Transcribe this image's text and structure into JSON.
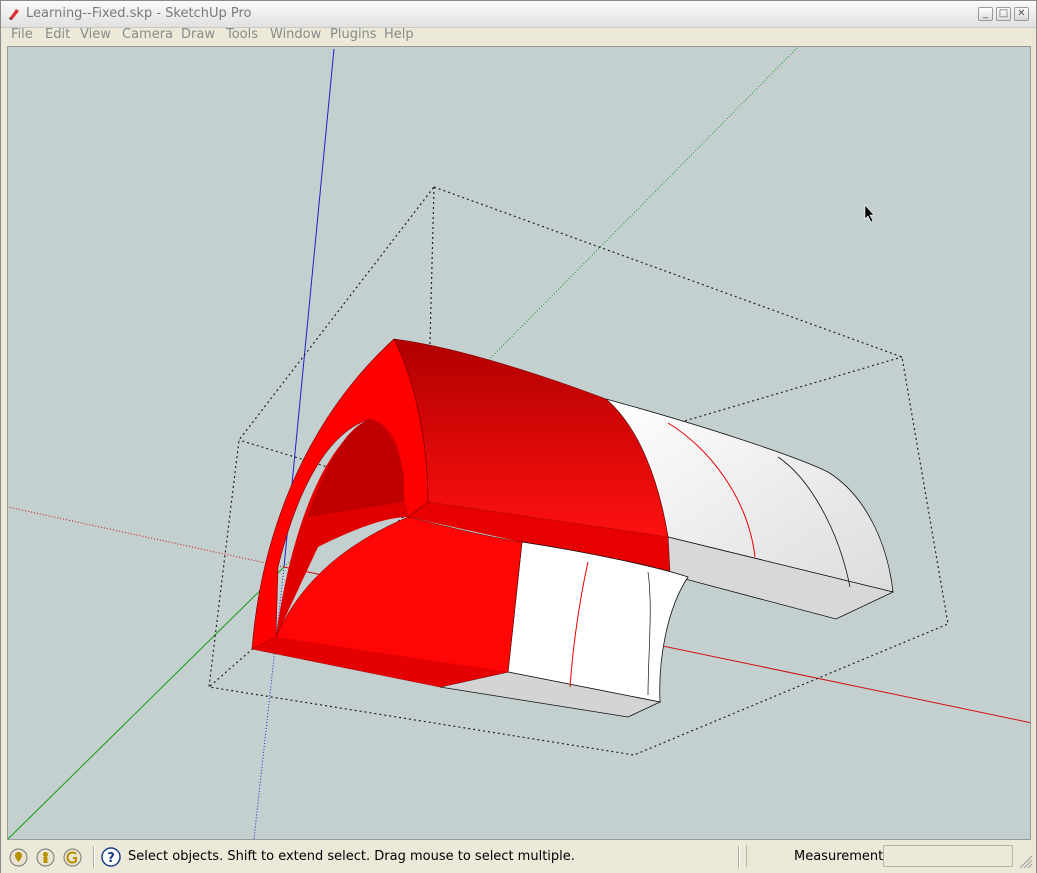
{
  "window": {
    "title": "Learning--Fixed.skp - SketchUp Pro",
    "controls": {
      "minimize": "minimize-icon",
      "maximize": "maximize-icon",
      "close": "close-icon"
    }
  },
  "menubar": {
    "items": [
      "File",
      "Edit",
      "View",
      "Camera",
      "Draw",
      "Tools",
      "Window",
      "Plugins",
      "Help"
    ]
  },
  "viewport": {
    "background_color": "#c4cfd0",
    "model_face_color": "#ff0000",
    "model_back_face_color": "#ffffff",
    "axis_colors": {
      "red": "#d11",
      "green": "#0a0",
      "blue": "#22c"
    },
    "cursor": "arrow-cursor-icon"
  },
  "statusbar": {
    "icons": [
      "geo-location-icon",
      "credits-icon",
      "sign-in-icon"
    ],
    "help_icon": "question-mark-icon",
    "message": "Select objects. Shift to extend select. Drag mouse to select multiple.",
    "measurements_label": "Measurements",
    "measurements_value": ""
  }
}
